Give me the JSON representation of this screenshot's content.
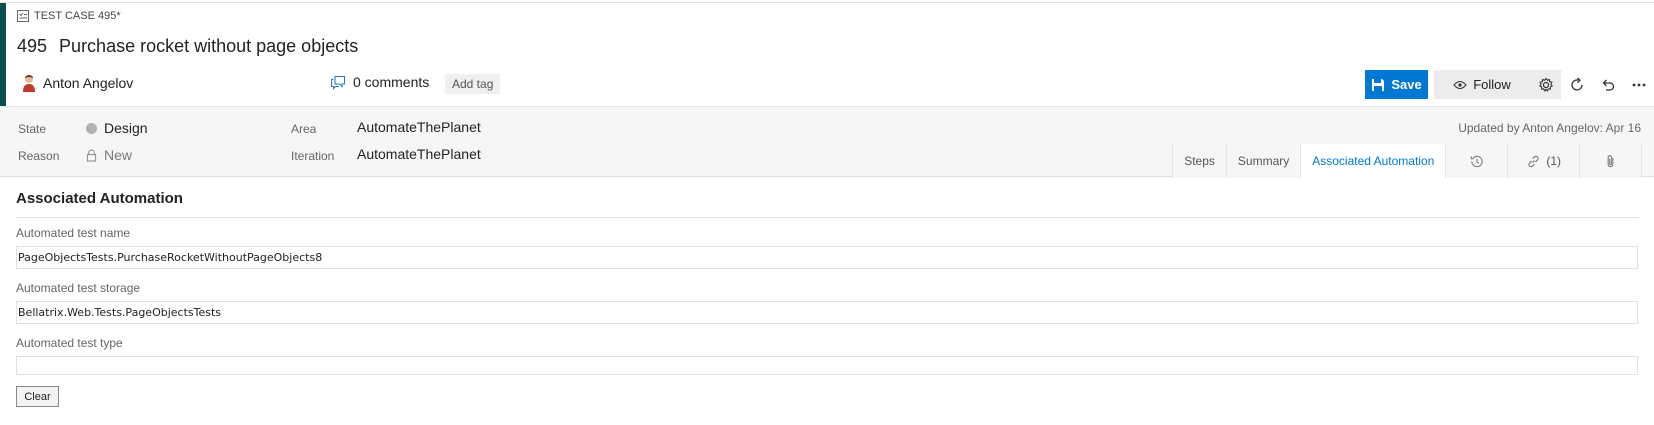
{
  "work_item": {
    "type_label": "TEST CASE 495*",
    "id": "495",
    "title": "Purchase rocket without page objects",
    "author": "Anton Angelov",
    "comments": "0 comments",
    "add_tag": "Add tag"
  },
  "toolbar": {
    "save_label": "Save",
    "follow_label": "Follow"
  },
  "fields": {
    "state_label": "State",
    "state_value": "Design",
    "reason_label": "Reason",
    "reason_value": "New",
    "area_label": "Area",
    "area_value": "AutomateThePlanet",
    "iteration_label": "Iteration",
    "iteration_value": "AutomateThePlanet",
    "updated": "Updated by Anton Angelov: Apr 16"
  },
  "tabs": {
    "steps": "Steps",
    "summary": "Summary",
    "associated_automation": "Associated Automation",
    "links": "(1)"
  },
  "automation": {
    "section_title": "Associated Automation",
    "name_label": "Automated test name",
    "name_value": "PageObjectsTests.PurchaseRocketWithoutPageObjects8",
    "storage_label": "Automated test storage",
    "storage_value": "Bellatrix.Web.Tests.PageObjectsTests",
    "type_label": "Automated test type",
    "type_value": "",
    "clear_label": "Clear"
  },
  "colors": {
    "accent": "#0078d4",
    "left_bar": "#0b4f4f"
  },
  "icons": [
    "test-case-icon",
    "avatar",
    "comment-icon",
    "save-icon",
    "eye-icon",
    "gear-icon",
    "refresh-icon",
    "undo-icon",
    "more-icon",
    "history-icon",
    "link-icon",
    "attachment-icon",
    "lock-icon"
  ]
}
